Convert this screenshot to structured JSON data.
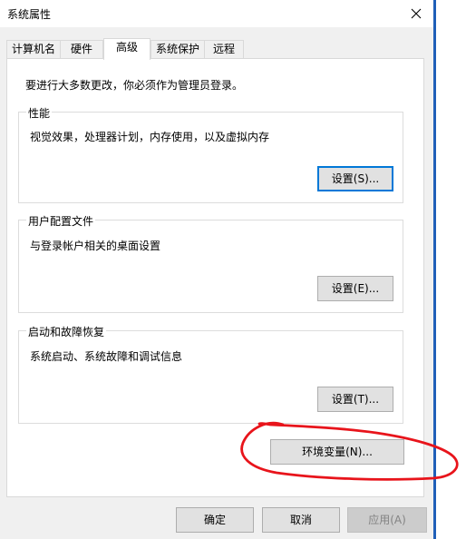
{
  "window": {
    "title": "系统属性",
    "close_glyph": "✕"
  },
  "tabs": [
    {
      "label": "计算机名",
      "active": false
    },
    {
      "label": "硬件",
      "active": false
    },
    {
      "label": "高级",
      "active": true
    },
    {
      "label": "系统保护",
      "active": false
    },
    {
      "label": "远程",
      "active": false
    }
  ],
  "notice": "要进行大多数更改，你必须作为管理员登录。",
  "groups": {
    "performance": {
      "title": "性能",
      "description": "视觉效果，处理器计划，内存使用，以及虚拟内存",
      "button": "设置(S)..."
    },
    "user_profiles": {
      "title": "用户配置文件",
      "description": "与登录帐户相关的桌面设置",
      "button": "设置(E)..."
    },
    "startup_recovery": {
      "title": "启动和故障恢复",
      "description": "系统启动、系统故障和调试信息",
      "button": "设置(T)..."
    }
  },
  "env_button": "环境变量(N)...",
  "footer": {
    "ok": "确定",
    "cancel": "取消",
    "apply": "应用(A)"
  },
  "colors": {
    "focus_border": "#0078d7",
    "annotation_ink": "#e8141b",
    "window_edge": "#1f5fb8"
  }
}
